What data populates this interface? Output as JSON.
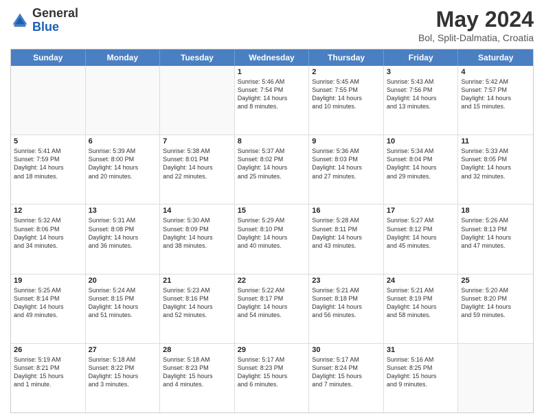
{
  "header": {
    "logo_general": "General",
    "logo_blue": "Blue",
    "main_title": "May 2024",
    "subtitle": "Bol, Split-Dalmatia, Croatia"
  },
  "days_of_week": [
    "Sunday",
    "Monday",
    "Tuesday",
    "Wednesday",
    "Thursday",
    "Friday",
    "Saturday"
  ],
  "rows": [
    [
      {
        "day": "",
        "lines": [],
        "empty": true
      },
      {
        "day": "",
        "lines": [],
        "empty": true
      },
      {
        "day": "",
        "lines": [],
        "empty": true
      },
      {
        "day": "1",
        "lines": [
          "Sunrise: 5:46 AM",
          "Sunset: 7:54 PM",
          "Daylight: 14 hours",
          "and 8 minutes."
        ],
        "empty": false
      },
      {
        "day": "2",
        "lines": [
          "Sunrise: 5:45 AM",
          "Sunset: 7:55 PM",
          "Daylight: 14 hours",
          "and 10 minutes."
        ],
        "empty": false
      },
      {
        "day": "3",
        "lines": [
          "Sunrise: 5:43 AM",
          "Sunset: 7:56 PM",
          "Daylight: 14 hours",
          "and 13 minutes."
        ],
        "empty": false
      },
      {
        "day": "4",
        "lines": [
          "Sunrise: 5:42 AM",
          "Sunset: 7:57 PM",
          "Daylight: 14 hours",
          "and 15 minutes."
        ],
        "empty": false
      }
    ],
    [
      {
        "day": "5",
        "lines": [
          "Sunrise: 5:41 AM",
          "Sunset: 7:59 PM",
          "Daylight: 14 hours",
          "and 18 minutes."
        ],
        "empty": false
      },
      {
        "day": "6",
        "lines": [
          "Sunrise: 5:39 AM",
          "Sunset: 8:00 PM",
          "Daylight: 14 hours",
          "and 20 minutes."
        ],
        "empty": false
      },
      {
        "day": "7",
        "lines": [
          "Sunrise: 5:38 AM",
          "Sunset: 8:01 PM",
          "Daylight: 14 hours",
          "and 22 minutes."
        ],
        "empty": false
      },
      {
        "day": "8",
        "lines": [
          "Sunrise: 5:37 AM",
          "Sunset: 8:02 PM",
          "Daylight: 14 hours",
          "and 25 minutes."
        ],
        "empty": false
      },
      {
        "day": "9",
        "lines": [
          "Sunrise: 5:36 AM",
          "Sunset: 8:03 PM",
          "Daylight: 14 hours",
          "and 27 minutes."
        ],
        "empty": false
      },
      {
        "day": "10",
        "lines": [
          "Sunrise: 5:34 AM",
          "Sunset: 8:04 PM",
          "Daylight: 14 hours",
          "and 29 minutes."
        ],
        "empty": false
      },
      {
        "day": "11",
        "lines": [
          "Sunrise: 5:33 AM",
          "Sunset: 8:05 PM",
          "Daylight: 14 hours",
          "and 32 minutes."
        ],
        "empty": false
      }
    ],
    [
      {
        "day": "12",
        "lines": [
          "Sunrise: 5:32 AM",
          "Sunset: 8:06 PM",
          "Daylight: 14 hours",
          "and 34 minutes."
        ],
        "empty": false
      },
      {
        "day": "13",
        "lines": [
          "Sunrise: 5:31 AM",
          "Sunset: 8:08 PM",
          "Daylight: 14 hours",
          "and 36 minutes."
        ],
        "empty": false
      },
      {
        "day": "14",
        "lines": [
          "Sunrise: 5:30 AM",
          "Sunset: 8:09 PM",
          "Daylight: 14 hours",
          "and 38 minutes."
        ],
        "empty": false
      },
      {
        "day": "15",
        "lines": [
          "Sunrise: 5:29 AM",
          "Sunset: 8:10 PM",
          "Daylight: 14 hours",
          "and 40 minutes."
        ],
        "empty": false
      },
      {
        "day": "16",
        "lines": [
          "Sunrise: 5:28 AM",
          "Sunset: 8:11 PM",
          "Daylight: 14 hours",
          "and 43 minutes."
        ],
        "empty": false
      },
      {
        "day": "17",
        "lines": [
          "Sunrise: 5:27 AM",
          "Sunset: 8:12 PM",
          "Daylight: 14 hours",
          "and 45 minutes."
        ],
        "empty": false
      },
      {
        "day": "18",
        "lines": [
          "Sunrise: 5:26 AM",
          "Sunset: 8:13 PM",
          "Daylight: 14 hours",
          "and 47 minutes."
        ],
        "empty": false
      }
    ],
    [
      {
        "day": "19",
        "lines": [
          "Sunrise: 5:25 AM",
          "Sunset: 8:14 PM",
          "Daylight: 14 hours",
          "and 49 minutes."
        ],
        "empty": false
      },
      {
        "day": "20",
        "lines": [
          "Sunrise: 5:24 AM",
          "Sunset: 8:15 PM",
          "Daylight: 14 hours",
          "and 51 minutes."
        ],
        "empty": false
      },
      {
        "day": "21",
        "lines": [
          "Sunrise: 5:23 AM",
          "Sunset: 8:16 PM",
          "Daylight: 14 hours",
          "and 52 minutes."
        ],
        "empty": false
      },
      {
        "day": "22",
        "lines": [
          "Sunrise: 5:22 AM",
          "Sunset: 8:17 PM",
          "Daylight: 14 hours",
          "and 54 minutes."
        ],
        "empty": false
      },
      {
        "day": "23",
        "lines": [
          "Sunrise: 5:21 AM",
          "Sunset: 8:18 PM",
          "Daylight: 14 hours",
          "and 56 minutes."
        ],
        "empty": false
      },
      {
        "day": "24",
        "lines": [
          "Sunrise: 5:21 AM",
          "Sunset: 8:19 PM",
          "Daylight: 14 hours",
          "and 58 minutes."
        ],
        "empty": false
      },
      {
        "day": "25",
        "lines": [
          "Sunrise: 5:20 AM",
          "Sunset: 8:20 PM",
          "Daylight: 14 hours",
          "and 59 minutes."
        ],
        "empty": false
      }
    ],
    [
      {
        "day": "26",
        "lines": [
          "Sunrise: 5:19 AM",
          "Sunset: 8:21 PM",
          "Daylight: 15 hours",
          "and 1 minute."
        ],
        "empty": false
      },
      {
        "day": "27",
        "lines": [
          "Sunrise: 5:18 AM",
          "Sunset: 8:22 PM",
          "Daylight: 15 hours",
          "and 3 minutes."
        ],
        "empty": false
      },
      {
        "day": "28",
        "lines": [
          "Sunrise: 5:18 AM",
          "Sunset: 8:23 PM",
          "Daylight: 15 hours",
          "and 4 minutes."
        ],
        "empty": false
      },
      {
        "day": "29",
        "lines": [
          "Sunrise: 5:17 AM",
          "Sunset: 8:23 PM",
          "Daylight: 15 hours",
          "and 6 minutes."
        ],
        "empty": false
      },
      {
        "day": "30",
        "lines": [
          "Sunrise: 5:17 AM",
          "Sunset: 8:24 PM",
          "Daylight: 15 hours",
          "and 7 minutes."
        ],
        "empty": false
      },
      {
        "day": "31",
        "lines": [
          "Sunrise: 5:16 AM",
          "Sunset: 8:25 PM",
          "Daylight: 15 hours",
          "and 9 minutes."
        ],
        "empty": false
      },
      {
        "day": "",
        "lines": [],
        "empty": true
      }
    ]
  ]
}
